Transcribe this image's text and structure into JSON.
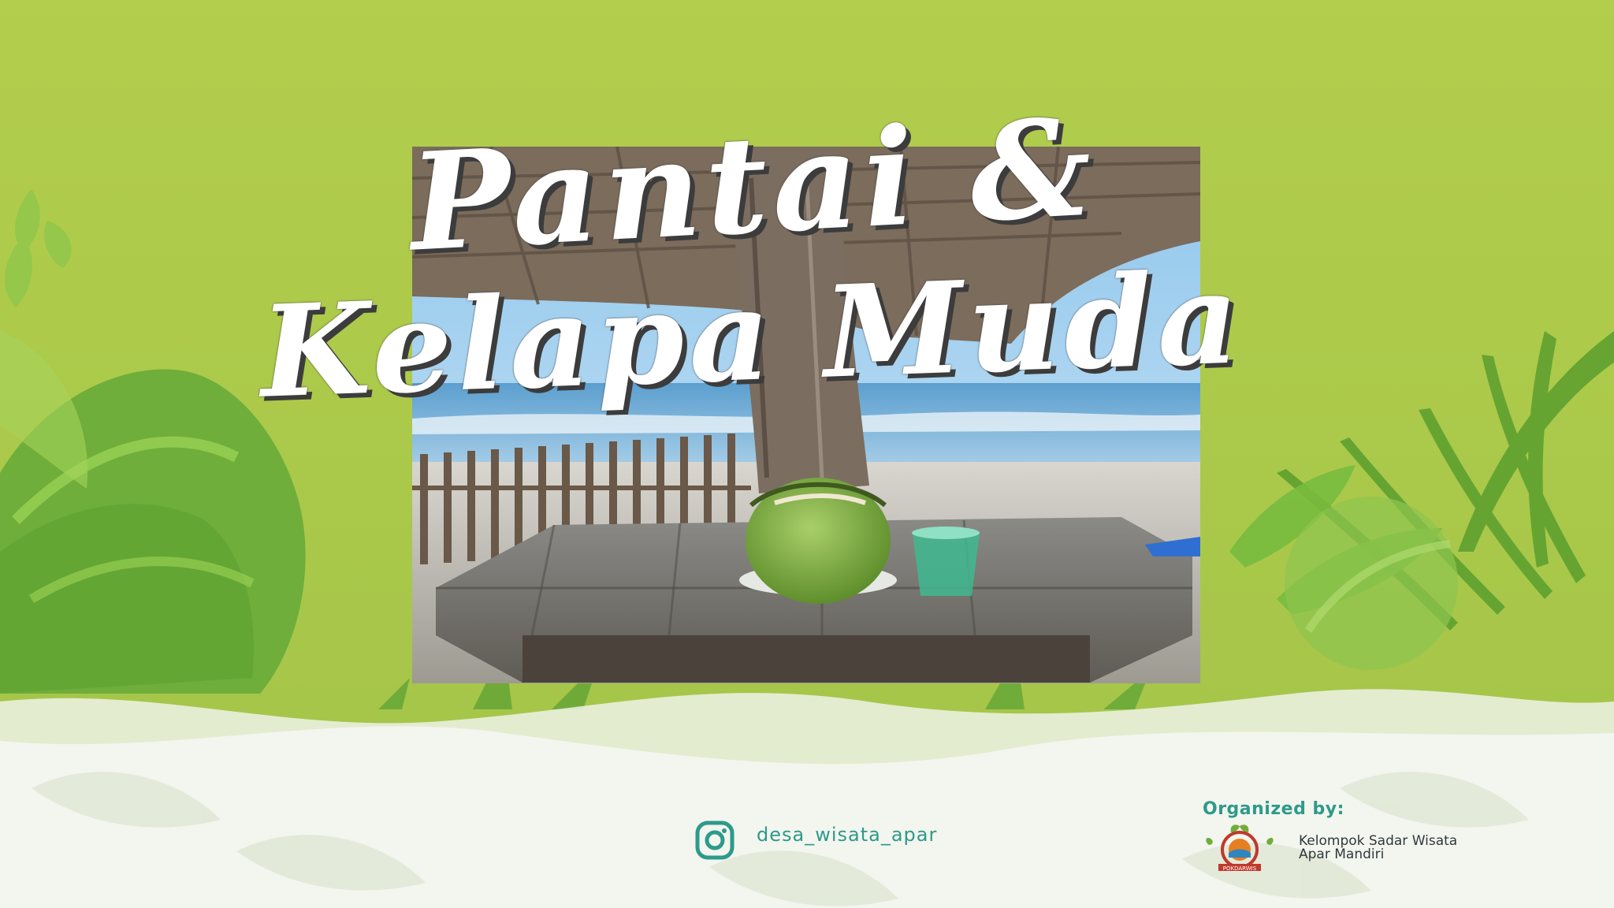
{
  "poster": {
    "title_line1": "Pantai &",
    "title_line2": "Kelapa Muda",
    "instagram_handle": "desa_wisata_apar",
    "organized_label": "Organized by:",
    "organizer_line1": "Kelompok Sadar Wisata",
    "organizer_line2": "Apar Mandiri",
    "logo_text": "POKDARWIS"
  },
  "icons": {
    "instagram": "instagram-icon",
    "logo": "pokdarwis-logo"
  },
  "colors": {
    "background": "#b0cb4b",
    "leaf_dark": "#6fae3b",
    "leaf_light": "#93c94b",
    "footer_white": "#f2f4ee",
    "teal_text": "#2e9a8a"
  }
}
